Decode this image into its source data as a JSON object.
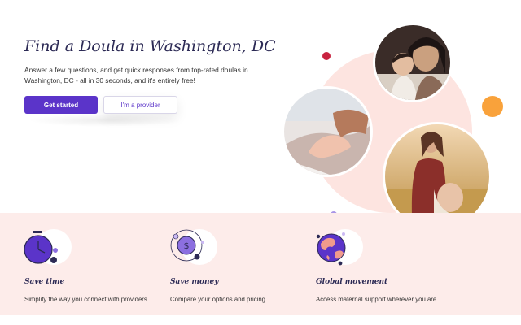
{
  "hero": {
    "title": "Find a Doula in Washington, DC",
    "subtitle": "Answer a few questions, and get quick responses from top-rated doulas in Washington, DC - all in 30 seconds, and it's entirely free!",
    "primary_button": "Get started",
    "secondary_button": "I'm a provider"
  },
  "features": [
    {
      "title": "Save time",
      "description": "Simplify the way you connect with providers",
      "icon": "clock-icon"
    },
    {
      "title": "Save money",
      "description": "Compare your options and pricing",
      "icon": "dollar-coin-icon"
    },
    {
      "title": "Global movement",
      "description": "Access maternal support wherever you are",
      "icon": "globe-icon"
    }
  ],
  "colors": {
    "brand_purple": "#5b34c9",
    "heading_navy": "#2c2a55",
    "blush": "#fde4e0",
    "accent_orange": "#f9a23b",
    "accent_red": "#c8223f"
  }
}
